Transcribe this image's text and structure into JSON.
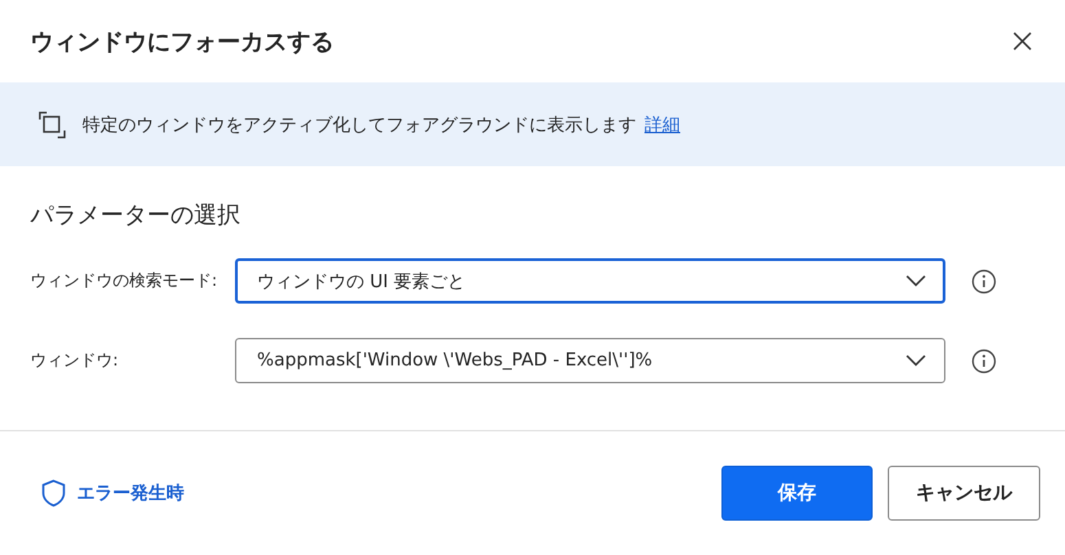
{
  "dialog": {
    "title": "ウィンドウにフォーカスする"
  },
  "banner": {
    "text": "特定のウィンドウをアクティブ化してフォアグラウンドに表示します",
    "link": "詳細"
  },
  "section": {
    "title": "パラメーターの選択"
  },
  "fields": [
    {
      "label": "ウィンドウの検索モード:",
      "value": "ウィンドウの UI 要素ごと",
      "focused": true
    },
    {
      "label": "ウィンドウ:",
      "value": "%appmask['Window \\'Webs_PAD - Excel\\'']%",
      "focused": false
    }
  ],
  "footer": {
    "error_link": "エラー発生時",
    "buttons": [
      {
        "label": "保存",
        "kind": "primary"
      },
      {
        "label": "キャンセル",
        "kind": "secondary"
      }
    ]
  }
}
